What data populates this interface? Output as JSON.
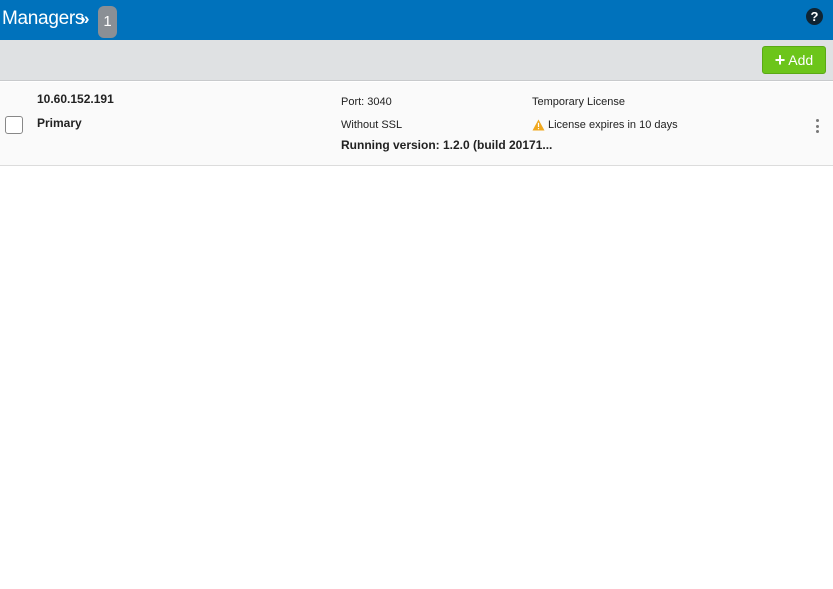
{
  "header": {
    "title": "Managers",
    "separator": "»",
    "count": "1",
    "help_symbol": "?"
  },
  "toolbar": {
    "add_plus": "+",
    "add_label": "Add"
  },
  "managers": [
    {
      "ip": "10.60.152.191",
      "role": "Primary",
      "port": "Port: 3040",
      "ssl": "Without SSL",
      "version": "Running version: 1.2.0 (build 20171...",
      "license": "Temporary License",
      "license_warning": "License expires in 10 days"
    }
  ],
  "colors": {
    "header_bg": "#0072bc",
    "toolbar_bg": "#dfe1e3",
    "add_button": "#6cc51a",
    "warning": "#f0a81e"
  }
}
